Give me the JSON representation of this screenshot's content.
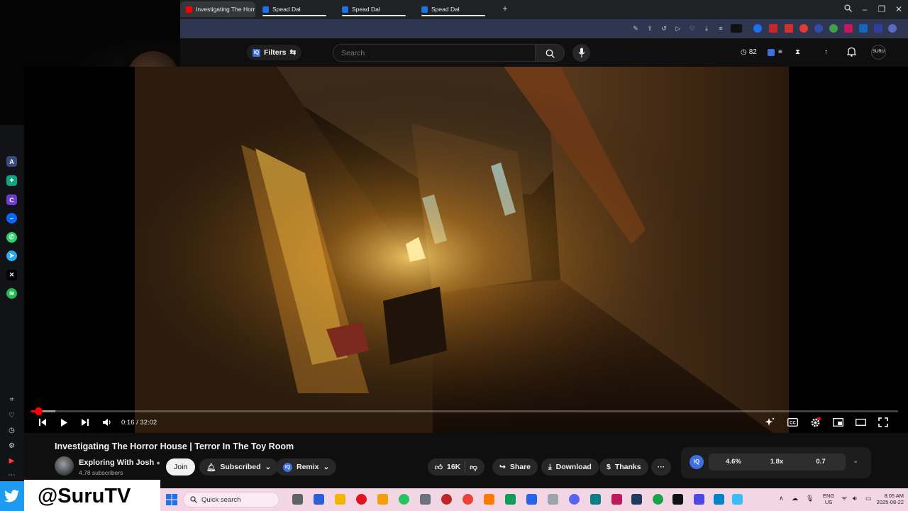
{
  "browser": {
    "tabs": [
      {
        "label": "Investigating The Horror H",
        "active": true,
        "favicon_color": "#ff0000"
      },
      {
        "label": "Spead Dal",
        "active": false,
        "favicon_color": "#1a73e8"
      },
      {
        "label": "Spead Dal",
        "active": false,
        "favicon_color": "#1a73e8"
      },
      {
        "label": "Spead Dal",
        "active": false,
        "favicon_color": "#1a73e8"
      }
    ],
    "new_tab_label": "+"
  },
  "youtube": {
    "filters_label": "Filters",
    "search_placeholder": "Search",
    "badge_count": "82",
    "avatar_label": "SURU"
  },
  "player": {
    "current_time": "0:16",
    "duration": "32:02",
    "time_display": "0:16 / 32:02",
    "progress_fraction": 0.0083,
    "buffer_fraction": 0.028
  },
  "video": {
    "title": "Investigating The Horror House | Terror In The Toy Room",
    "channel_name": "Exploring With Josh",
    "subscribers": "4.78 subscribers",
    "join_label": "Join",
    "subscribed_label": "Subscribed",
    "remix_label": "Remix",
    "like_count": "16K",
    "share_label": "Share",
    "download_label": "Download",
    "thanks_label": "Thanks",
    "more_label": "···"
  },
  "stats_panel": {
    "values": [
      "4.6%",
      "1.8x",
      "0.7"
    ]
  },
  "stream_overlay": {
    "handle": "@SuruTV"
  },
  "taskbar": {
    "search_label": "Quick search",
    "lang_top": "ENG",
    "lang_bottom": "US",
    "time": "8:05 AM",
    "date": "2025-08-22"
  },
  "colors": {
    "brand_red": "#ff0000",
    "twitter_blue": "#1d9bf0",
    "taskbar_pink": "#f3d6e3"
  }
}
